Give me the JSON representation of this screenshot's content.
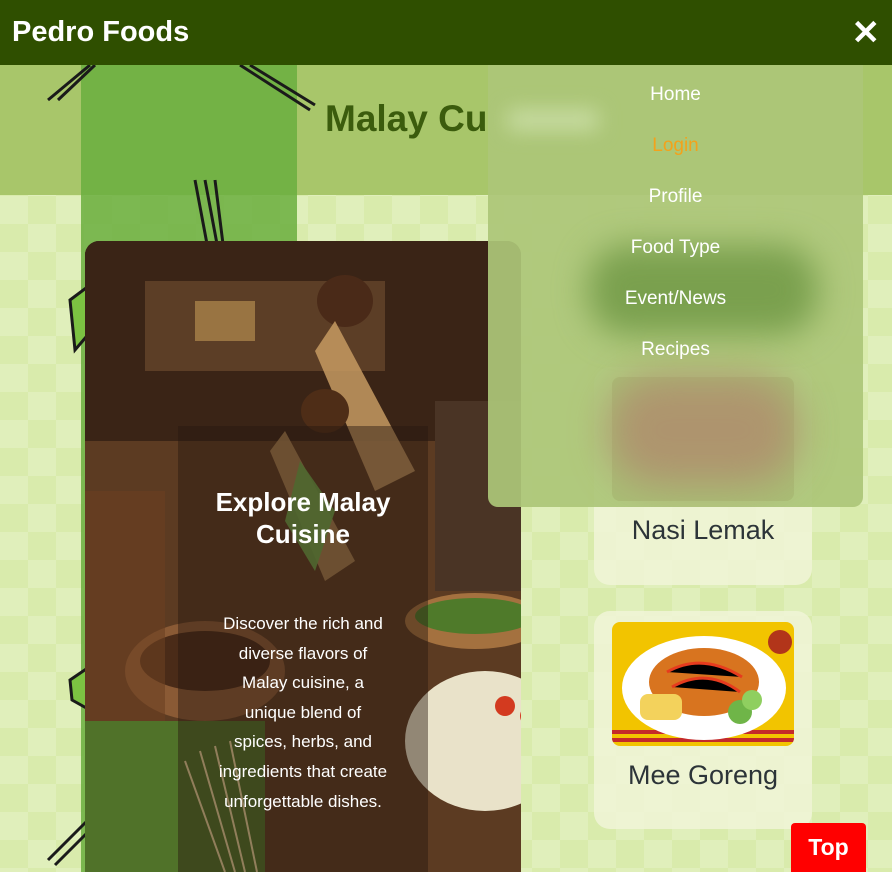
{
  "topbar": {
    "brand": "Pedro Foods",
    "close_glyph": "✕"
  },
  "header": {
    "title": "Malay Cuisine"
  },
  "menu": {
    "items": [
      {
        "label": "Home",
        "active": false
      },
      {
        "label": "Login",
        "active": true
      },
      {
        "label": "Profile",
        "active": false
      },
      {
        "label": "Food Type",
        "active": false
      },
      {
        "label": "Event/News",
        "active": false
      },
      {
        "label": "Recipes",
        "active": false
      }
    ],
    "active_color": "#f3a21b"
  },
  "hero": {
    "title": "Explore Malay Cuisine",
    "description": "Discover the rich and diverse flavors of Malay cuisine, a unique blend of spices, herbs, and ingredients that create unforgettable dishes."
  },
  "foods": [
    {
      "name": "Nasi Lemak"
    },
    {
      "name": "Mee Goreng"
    }
  ],
  "top_button": {
    "label": "Top",
    "color": "#ff0000"
  },
  "colors": {
    "topbar": "#2f4f00",
    "background": "#d9ebac",
    "title": "#3b5c0d"
  }
}
